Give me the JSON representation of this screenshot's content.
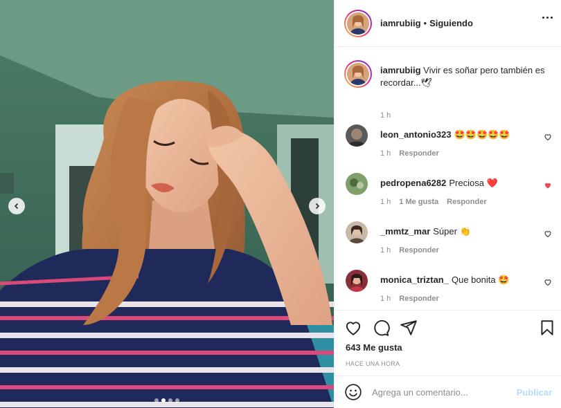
{
  "header": {
    "username": "iamrubiig",
    "separator": "•",
    "follow_status": "Siguiendo"
  },
  "caption": {
    "username": "iamrubiig",
    "text": "Vivir es soñar pero también es recordar...🕊",
    "time": "1 h"
  },
  "comments": [
    {
      "username": "leon_antonio323",
      "text": "🤩🤩🤩🤩🤩",
      "time": "1 h",
      "likes": "",
      "reply": "Responder",
      "liked": false
    },
    {
      "username": "pedropena6282",
      "text": "Preciosa ❤️",
      "time": "1 h",
      "likes": "1 Me gusta",
      "reply": "Responder",
      "liked": true
    },
    {
      "username": "_mmtz_mar",
      "text": "Súper 👏",
      "time": "1 h",
      "likes": "",
      "reply": "Responder",
      "liked": false
    },
    {
      "username": "monica_triztan_",
      "text": "Que bonita 🤩",
      "time": "1 h",
      "likes": "",
      "reply": "Responder",
      "liked": false
    }
  ],
  "actions": {
    "likes_label": "643 Me gusta",
    "time_ago": "HACE UNA HORA"
  },
  "add_comment": {
    "placeholder": "Agrega un comentario...",
    "publish_label": "Publicar"
  },
  "colors": {
    "heart_liked": "#ed4956",
    "publish_disabled": "#b3dbff",
    "muted_text": "#8e8e8e"
  },
  "carousel": {
    "slides": 4,
    "active_index": 1
  }
}
